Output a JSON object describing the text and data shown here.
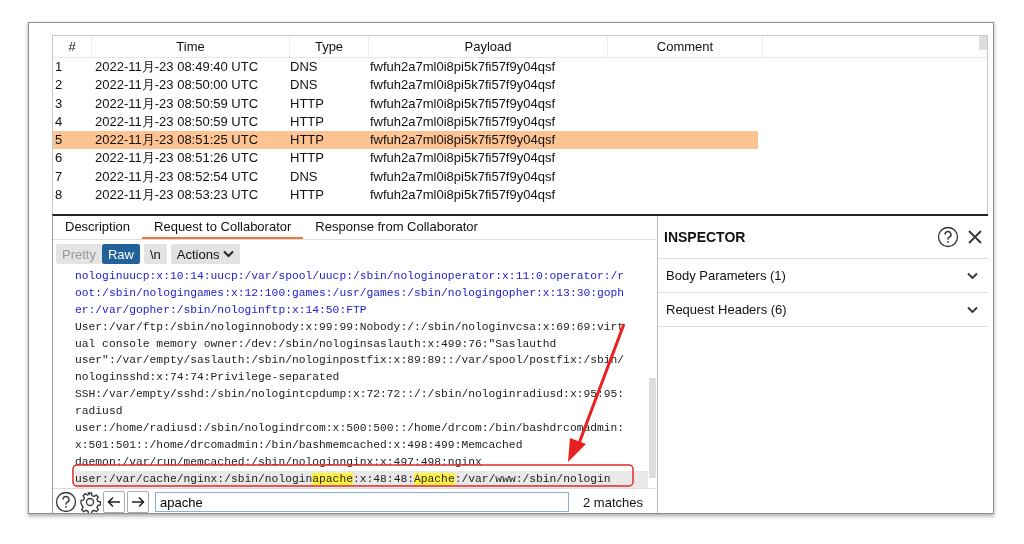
{
  "table": {
    "columns": [
      "#",
      "Time",
      "Type",
      "Payload",
      "Comment"
    ],
    "rows": [
      {
        "num": "1",
        "time": "2022-11月-23 08:49:40 UTC",
        "type": "DNS",
        "payload": "fwfuh2a7ml0i8pi5k7fi57f9y04qsf",
        "selected": false
      },
      {
        "num": "2",
        "time": "2022-11月-23 08:50:00 UTC",
        "type": "DNS",
        "payload": "fwfuh2a7ml0i8pi5k7fi57f9y04qsf",
        "selected": false
      },
      {
        "num": "3",
        "time": "2022-11月-23 08:50:59 UTC",
        "type": "HTTP",
        "payload": "fwfuh2a7ml0i8pi5k7fi57f9y04qsf",
        "selected": false
      },
      {
        "num": "4",
        "time": "2022-11月-23 08:50:59 UTC",
        "type": "HTTP",
        "payload": "fwfuh2a7ml0i8pi5k7fi57f9y04qsf",
        "selected": false
      },
      {
        "num": "5",
        "time": "2022-11月-23 08:51:25 UTC",
        "type": "HTTP",
        "payload": "fwfuh2a7ml0i8pi5k7fi57f9y04qsf",
        "selected": true
      },
      {
        "num": "6",
        "time": "2022-11月-23 08:51:26 UTC",
        "type": "HTTP",
        "payload": "fwfuh2a7ml0i8pi5k7fi57f9y04qsf",
        "selected": false
      },
      {
        "num": "7",
        "time": "2022-11月-23 08:52:54 UTC",
        "type": "DNS",
        "payload": "fwfuh2a7ml0i8pi5k7fi57f9y04qsf",
        "selected": false
      },
      {
        "num": "8",
        "time": "2022-11月-23 08:53:23 UTC",
        "type": "HTTP",
        "payload": "fwfuh2a7ml0i8pi5k7fi57f9y04qsf",
        "selected": false
      }
    ]
  },
  "tabs": [
    {
      "label": "Description",
      "selected": false
    },
    {
      "label": "Request to Collaborator",
      "selected": true
    },
    {
      "label": "Response from Collaborator",
      "selected": false
    }
  ],
  "toolbar": {
    "view_buttons": [
      {
        "label": "Pretty",
        "selected": false
      },
      {
        "label": "Raw",
        "selected": true
      }
    ],
    "newline_button": "\\n",
    "actions": "Actions"
  },
  "editor": {
    "lines": [
      {
        "kind": "param",
        "segments": [
          {
            "text": "nologinuucp:x:10:14:uucp:/var/spool/uucp:/sbin/nologinoperator:x:11:0:operator:/r",
            "match": false
          }
        ],
        "current": false
      },
      {
        "kind": "param",
        "segments": [
          {
            "text": "oot:/sbin/nologingames:x:12:100:games:/usr/games:/sbin/nologingopher:x:13:30:goph",
            "match": false
          }
        ],
        "current": false
      },
      {
        "kind": "param",
        "segments": [
          {
            "text": "er:/var/gopher:/sbin/nologinftp:x:14:50:FTP",
            "match": false
          }
        ],
        "current": false
      },
      {
        "kind": "text",
        "segments": [
          {
            "text": "User:/var/ftp:/sbin/nologinnobody:x:99:99:Nobody:/:/sbin/nologinvcsa:x:69:69:virt",
            "match": false
          }
        ],
        "current": false
      },
      {
        "kind": "text",
        "segments": [
          {
            "text": "ual console memory owner:/dev:/sbin/nologinsaslauth:x:499:76:\"Saslauthd",
            "match": false
          }
        ],
        "current": false
      },
      {
        "kind": "text",
        "segments": [
          {
            "text": "user\":/var/empty/saslauth:/sbin/nologinpostfix:x:89:89::/var/spool/postfix:/sbin/",
            "match": false
          }
        ],
        "current": false
      },
      {
        "kind": "text",
        "segments": [
          {
            "text": "nologinsshd:x:74:74:Privilege-separated",
            "match": false
          }
        ],
        "current": false
      },
      {
        "kind": "text",
        "segments": [
          {
            "text": "SSH:/var/empty/sshd:/sbin/nologintcpdump:x:72:72::/:/sbin/nologinradiusd:x:95:95:",
            "match": false
          }
        ],
        "current": false
      },
      {
        "kind": "text",
        "segments": [
          {
            "text": "radiusd",
            "match": false
          }
        ],
        "current": false
      },
      {
        "kind": "text",
        "segments": [
          {
            "text": "user:/home/radiusd:/sbin/nologindrcom:x:500:500::/home/drcom:/bin/bashdrcomadmin:",
            "match": false
          }
        ],
        "current": false
      },
      {
        "kind": "text",
        "segments": [
          {
            "text": "x:501:501::/home/drcomadmin:/bin/bashmemcached:x:498:499:Memcached",
            "match": false
          }
        ],
        "current": false
      },
      {
        "kind": "text",
        "segments": [
          {
            "text": "daemon:/var/run/memcached:/sbin/nologinnginx:x:497:498:nginx",
            "match": false
          }
        ],
        "current": false
      },
      {
        "kind": "text",
        "segments": [
          {
            "text": "user:/var/cache/nginx:/sbin/nologin",
            "match": false
          },
          {
            "text": "apache",
            "match": true
          },
          {
            "text": ":x:48:48:",
            "match": false
          },
          {
            "text": "Apache",
            "match": true
          },
          {
            "text": ":/var/www:/sbin/nologin",
            "match": false
          }
        ],
        "current": true
      }
    ]
  },
  "search": {
    "value": "apache",
    "matches": "2 matches"
  },
  "inspector": {
    "title": "INSPECTOR",
    "sections": [
      {
        "label": "Body Parameters (1)",
        "expanded": false
      },
      {
        "label": "Request Headers (6)",
        "expanded": false
      }
    ]
  }
}
